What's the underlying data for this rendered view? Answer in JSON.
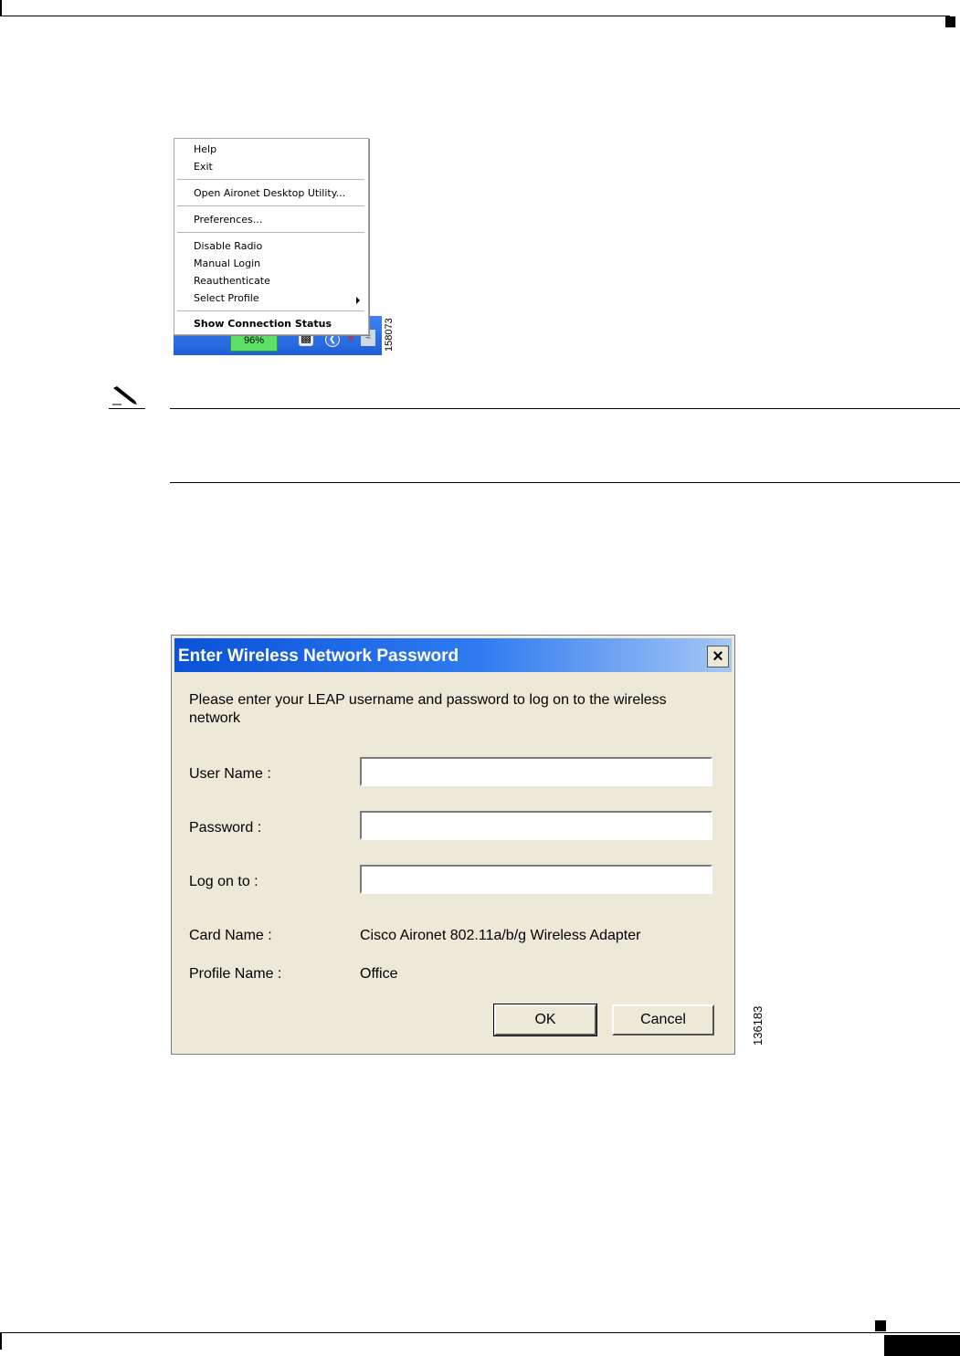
{
  "tray_menu": {
    "items": [
      {
        "label": "Help"
      },
      {
        "label": "Exit"
      },
      {
        "label": "Open Aironet Desktop Utility..."
      },
      {
        "label": "Preferences..."
      },
      {
        "label": "Disable Radio"
      },
      {
        "label": "Manual Login"
      },
      {
        "label": "Reauthenticate"
      },
      {
        "label": "Select Profile"
      },
      {
        "label": "Show Connection Status"
      }
    ],
    "battery_label": "96%",
    "icons": [
      "power-plug-icon",
      "sync-icon",
      "network-x-icon",
      "wireless-icon"
    ]
  },
  "figure_numbers": {
    "tray": "158073",
    "dialog": "136183"
  },
  "note": {
    "icon": "pencil-icon"
  },
  "dialog": {
    "title": "Enter Wireless Network Password",
    "close_label": "×",
    "instruction_line1": "Please enter your LEAP username and password to log on to the wireless",
    "instruction_line2": "network",
    "user_name_label": "User Name :",
    "user_name_value": "",
    "password_label": "Password :",
    "password_value": "",
    "logon_label": "Log on to :",
    "logon_value": "",
    "card_name_label": "Card Name :",
    "card_name_value": "Cisco Aironet 802.11a/b/g Wireless Adapter",
    "profile_name_label": "Profile Name :",
    "profile_name_value": "Office",
    "ok_label": "OK",
    "cancel_label": "Cancel",
    "colors": {
      "title_bar_start": "#0a52d8",
      "title_bar_end": "#a6c6f5",
      "body": "#ece9d8"
    }
  }
}
